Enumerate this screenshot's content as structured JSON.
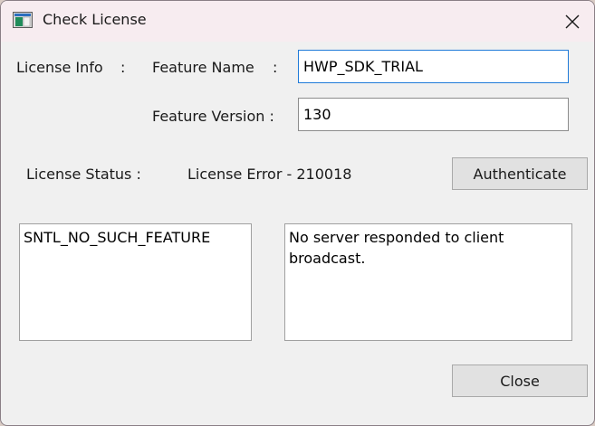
{
  "window": {
    "title": "Check License",
    "close_icon": "close-icon",
    "app_icon": "license-app-icon"
  },
  "license_info": {
    "label": "License Info",
    "separator": ":",
    "feature_name_label": "Feature Name",
    "feature_name_value": "HWP_SDK_TRIAL",
    "feature_version_label": "Feature Version :",
    "feature_version_value": "130"
  },
  "status": {
    "label": "License Status :",
    "value": "License Error - 210018",
    "authenticate_label": "Authenticate"
  },
  "output": {
    "left_text": "SNTL_NO_SUCH_FEATURE",
    "right_text": "No server responded to client broadcast."
  },
  "footer": {
    "close_label": "Close"
  }
}
